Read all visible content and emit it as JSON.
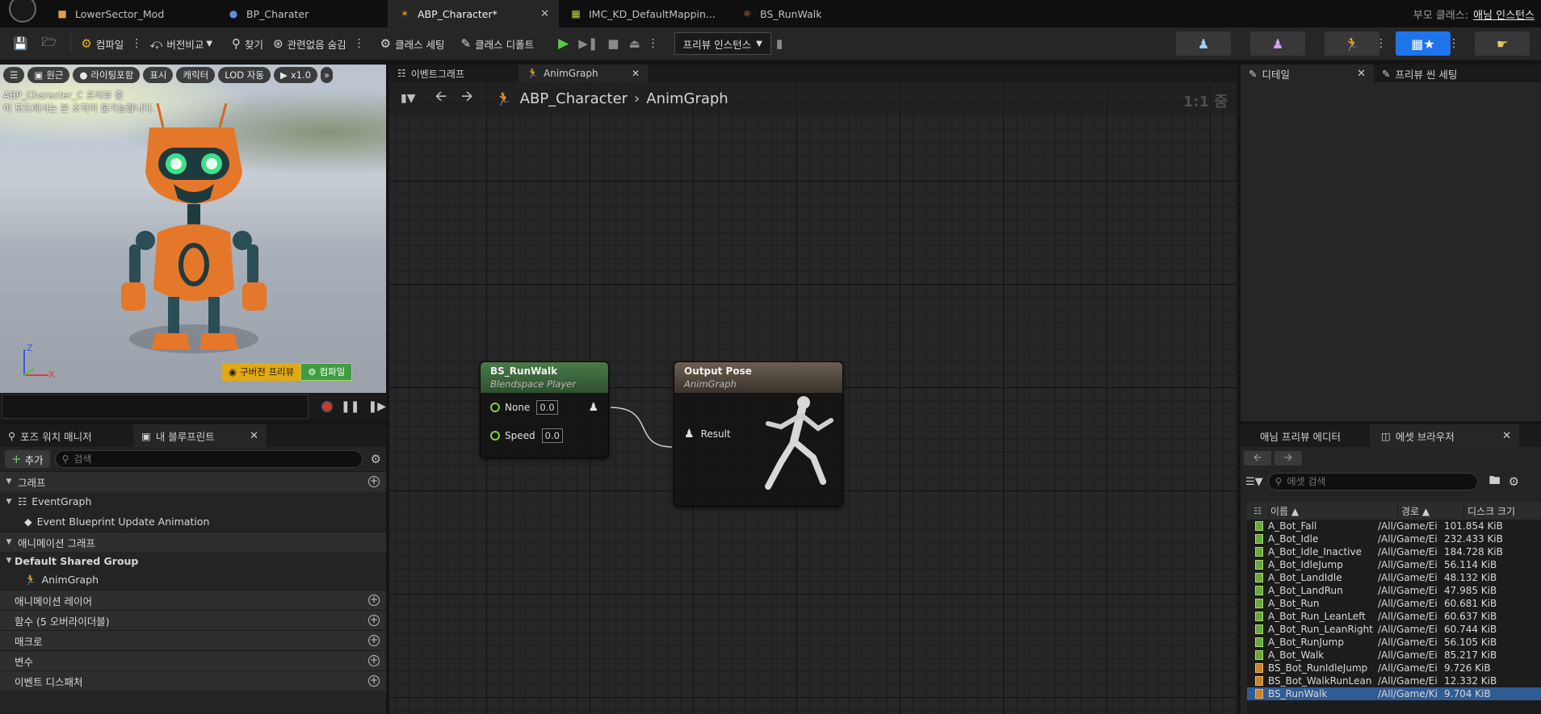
{
  "tabs": [
    {
      "label": "LowerSector_Mod",
      "icon": "level-icon",
      "active": false
    },
    {
      "label": "BP_Charater",
      "icon": "blueprint-person-icon",
      "active": false
    },
    {
      "label": "ABP_Character*",
      "icon": "anim-blueprint-icon",
      "active": true
    },
    {
      "label": "IMC_KD_DefaultMappin...",
      "icon": "input-mapping-icon",
      "active": false
    },
    {
      "label": "BS_RunWalk",
      "icon": "blendspace-icon",
      "active": false
    }
  ],
  "parent_class": {
    "label": "부모 클래스:",
    "value": "애님 인스턴스"
  },
  "toolbar": {
    "compile": "컴파일",
    "diff": "버전비교",
    "find": "찾기",
    "hide_unrelated": "관련없음 숨김",
    "class_settings": "클래스 세팅",
    "class_defaults": "클래스 디폴트",
    "preview_instance": "프리뷰 인스턴스"
  },
  "viewport": {
    "pills": [
      "원근",
      "라이팅포함",
      "표시",
      "캐릭터",
      "LOD 자동",
      "x1.0"
    ],
    "info_line1": "ABP_Character_C 프리뷰 중",
    "info_line2": "이 모드에서는 본 조작이 불가능합니다.",
    "stale_preview": "구버전 프리뷰",
    "compile": "컴파일",
    "axis_z": "Z",
    "axis_x": "X"
  },
  "left_tabs": {
    "pose_watch": "포즈 워치 매니저",
    "my_blueprint": "내 블루프린트"
  },
  "my_blueprint": {
    "add": "추가",
    "search_placeholder": "검색",
    "graphs": "그래프",
    "event_graph": "EventGraph",
    "event_update": "Event Blueprint Update Animation",
    "anim_graphs": "애니메이션 그래프",
    "shared_group": "Default Shared Group",
    "anim_graph": "AnimGraph",
    "anim_layers": "애니메이션 레이어",
    "functions": "함수 (5 오버라이더블)",
    "macros": "매크로",
    "variables": "변수",
    "dispatchers": "이벤트 디스패처"
  },
  "graph_tabs": {
    "event_graph": "이벤트그래프",
    "anim_graph": "AnimGraph"
  },
  "breadcrumb": {
    "root": "ABP_Character",
    "current": "AnimGraph"
  },
  "zoom": "1:1 줌",
  "nodes": {
    "blendspace": {
      "title": "BS_RunWalk",
      "subtitle": "Blendspace Player",
      "pin1": "None",
      "pin1_val": "0.0",
      "pin2": "Speed",
      "pin2_val": "0.0"
    },
    "output": {
      "title": "Output Pose",
      "subtitle": "AnimGraph",
      "pin": "Result"
    }
  },
  "details_tabs": {
    "details": "디테일",
    "preview_scene": "프리뷰 씬 세팅"
  },
  "asset_tabs": {
    "anim_preview": "애님 프리뷰 에디터",
    "asset_browser": "에셋 브라우저"
  },
  "asset_browser": {
    "search_placeholder": "에셋 검색",
    "col_name": "이름",
    "col_path": "경로",
    "col_size": "디스크 크기",
    "rows": [
      {
        "name": "A_Bot_Fall",
        "path": "/All/Game/Ei",
        "size": "101.854 KiB",
        "type": "anim"
      },
      {
        "name": "A_Bot_Idle",
        "path": "/All/Game/Ei",
        "size": "232.433 KiB",
        "type": "anim"
      },
      {
        "name": "A_Bot_Idle_Inactive",
        "path": "/All/Game/Ei",
        "size": "184.728 KiB",
        "type": "anim"
      },
      {
        "name": "A_Bot_IdleJump",
        "path": "/All/Game/Ei",
        "size": "56.114 KiB",
        "type": "anim"
      },
      {
        "name": "A_Bot_LandIdle",
        "path": "/All/Game/Ei",
        "size": "48.132 KiB",
        "type": "anim"
      },
      {
        "name": "A_Bot_LandRun",
        "path": "/All/Game/Ei",
        "size": "47.985 KiB",
        "type": "anim"
      },
      {
        "name": "A_Bot_Run",
        "path": "/All/Game/Ei",
        "size": "60.681 KiB",
        "type": "anim"
      },
      {
        "name": "A_Bot_Run_LeanLeft",
        "path": "/All/Game/Ei",
        "size": "60.637 KiB",
        "type": "anim"
      },
      {
        "name": "A_Bot_Run_LeanRight",
        "path": "/All/Game/Ei",
        "size": "60.744 KiB",
        "type": "anim"
      },
      {
        "name": "A_Bot_RunJump",
        "path": "/All/Game/Ei",
        "size": "56.105 KiB",
        "type": "anim"
      },
      {
        "name": "A_Bot_Walk",
        "path": "/All/Game/Ei",
        "size": "85.217 KiB",
        "type": "anim"
      },
      {
        "name": "BS_Bot_RunIdleJump",
        "path": "/All/Game/Ei",
        "size": "9.726 KiB",
        "type": "bs"
      },
      {
        "name": "BS_Bot_WalkRunLean",
        "path": "/All/Game/Ei",
        "size": "12.332 KiB",
        "type": "bs"
      },
      {
        "name": "BS_RunWalk",
        "path": "/All/Game/Ki",
        "size": "9.704 KiB",
        "type": "bs",
        "selected": true
      }
    ]
  },
  "colors": {
    "accent_blue": "#1e74ea",
    "pin_green": "#7fd13a",
    "blendspace_header": "#3f6b3f",
    "output_header": "#5c5247"
  }
}
